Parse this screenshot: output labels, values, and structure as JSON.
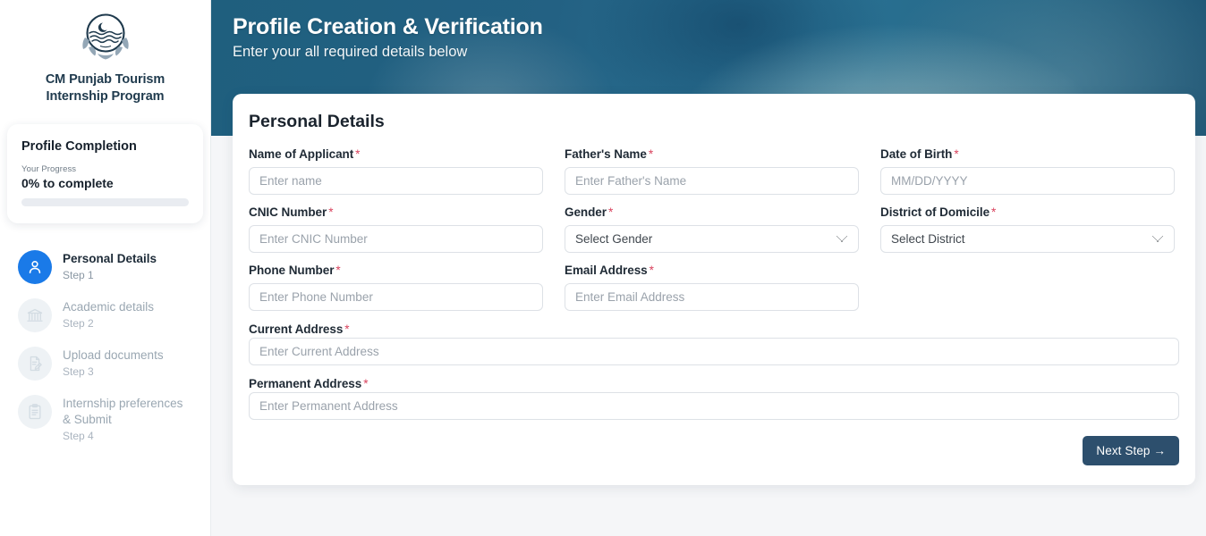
{
  "sidebar": {
    "logo_icon": "punjab-govt-crest-icon",
    "brand_line1": "CM Punjab Tourism",
    "brand_line2": "Internship Program",
    "progress": {
      "title": "Profile Completion",
      "subtitle": "Your Progress",
      "status": "0% to complete",
      "percent": 0,
      "fill_color": "#1a7ae8",
      "track_color": "#e9ecf1"
    },
    "steps": [
      {
        "icon": "user-icon",
        "label": "Personal Details",
        "step": "Step 1",
        "active": true
      },
      {
        "icon": "university-icon",
        "label": "Academic details",
        "step": "Step 2",
        "active": false
      },
      {
        "icon": "document-edit-icon",
        "label": "Upload documents",
        "step": "Step 3",
        "active": false
      },
      {
        "icon": "clipboard-icon",
        "label": "Internship preferences & Submit",
        "step": "Step 4",
        "active": false
      }
    ]
  },
  "hero": {
    "title": "Profile Creation & Verification",
    "subtitle": "Enter your all required details below"
  },
  "card": {
    "title": "Personal Details",
    "fields": {
      "name": {
        "label": "Name of Applicant",
        "required": "*",
        "placeholder": "Enter name",
        "value": ""
      },
      "father": {
        "label": "Father's Name",
        "required": "*",
        "placeholder": "Enter Father's Name",
        "value": ""
      },
      "dob": {
        "label": "Date of Birth",
        "required": "*",
        "placeholder": "MM/DD/YYYY",
        "value": ""
      },
      "cnic": {
        "label": "CNIC Number",
        "required": "*",
        "placeholder": "Enter CNIC Number",
        "value": ""
      },
      "gender": {
        "label": "Gender",
        "required": "*",
        "selected": "Select Gender"
      },
      "district": {
        "label": "District of Domicile",
        "required": "*",
        "selected": "Select District"
      },
      "phone": {
        "label": "Phone Number",
        "required": "*",
        "placeholder": "Enter Phone Number",
        "value": ""
      },
      "email": {
        "label": "Email Address",
        "required": "*",
        "placeholder": "Enter Email Address",
        "value": ""
      },
      "current_address": {
        "label": "Current Address",
        "required": "*",
        "placeholder": "Enter Current Address",
        "value": ""
      },
      "permanent_address": {
        "label": "Permanent Address",
        "required": "*",
        "placeholder": "Enter Permanent Address",
        "value": ""
      }
    },
    "next_button": "Next Step →"
  },
  "colors": {
    "accent_blue": "#1a7ae8",
    "hero_blue": "#236183",
    "button_navy": "#2d4f6d",
    "required_red": "#d9435e"
  }
}
